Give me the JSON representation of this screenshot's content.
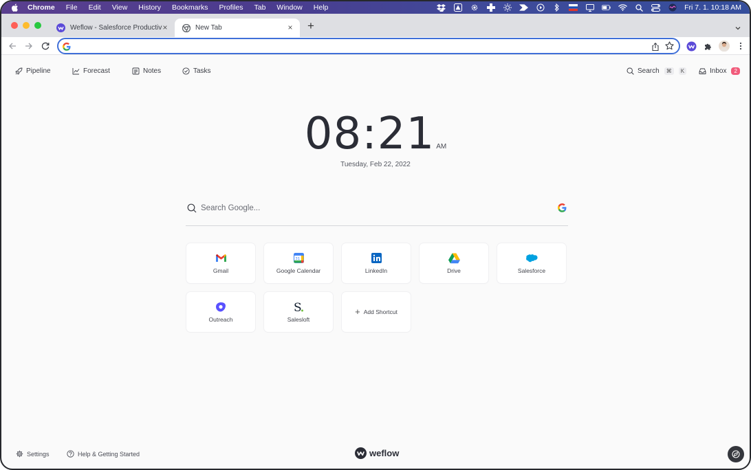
{
  "menubar": {
    "items": [
      "Chrome",
      "File",
      "Edit",
      "View",
      "History",
      "Bookmarks",
      "Profiles",
      "Tab",
      "Window",
      "Help"
    ],
    "clock": "Fri 7. 1.  10:18 AM"
  },
  "tabs": [
    {
      "title": "Weflow - Salesforce Productivity",
      "favicon": "weflow-icon"
    },
    {
      "title": "New Tab",
      "favicon": "chrome-icon"
    }
  ],
  "omnibox": {
    "value": "",
    "placeholder": ""
  },
  "appnav": {
    "pipeline": "Pipeline",
    "forecast": "Forecast",
    "notes": "Notes",
    "tasks": "Tasks",
    "search": "Search",
    "search_kbd1": "⌘",
    "search_kbd2": "K",
    "inbox": "Inbox",
    "inbox_count": "2"
  },
  "clock": {
    "time": "08:21",
    "ampm": "AM",
    "date": "Tuesday, Feb 22, 2022"
  },
  "search": {
    "placeholder": "Search Google..."
  },
  "shortcuts": [
    {
      "label": "Gmail",
      "icon": "gmail-icon"
    },
    {
      "label": "Google Calendar",
      "icon": "google-calendar-icon"
    },
    {
      "label": "LinkedIn",
      "icon": "linkedin-icon"
    },
    {
      "label": "Drive",
      "icon": "drive-icon"
    },
    {
      "label": "Salesforce",
      "icon": "salesforce-icon"
    },
    {
      "label": "Outreach",
      "icon": "outreach-icon"
    },
    {
      "label": "Salesloft",
      "icon": "salesloft-icon"
    },
    {
      "label": "Add Shortcut",
      "icon": "plus-icon"
    }
  ],
  "footer": {
    "settings": "Settings",
    "help": "Help & Getting Started",
    "brand": "weflow"
  },
  "colors": {
    "accent": "#3f6fd8",
    "badge": "#f15b7b",
    "menubar": "#4b3c8e"
  }
}
